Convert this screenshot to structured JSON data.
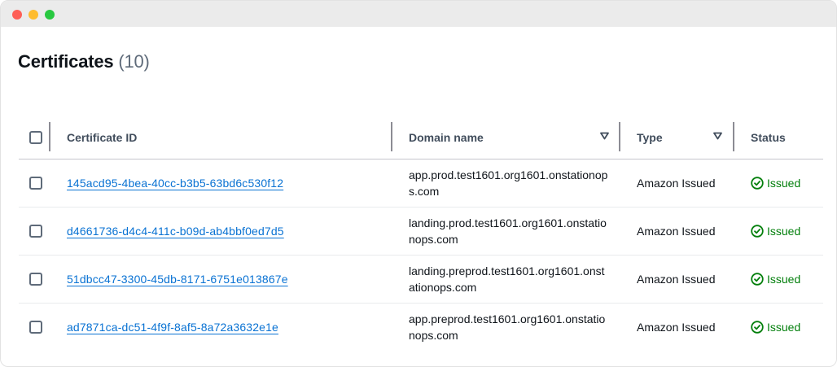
{
  "page": {
    "title": "Certificates",
    "count": "(10)"
  },
  "table": {
    "columns": {
      "certificate_id": "Certificate ID",
      "domain_name": "Domain name",
      "type": "Type",
      "status": "Status"
    },
    "rows": [
      {
        "certificate_id": "145acd95-4bea-40cc-b3b5-63bd6c530f12",
        "domain_name": "app.prod.test1601.org1601.onstationops.com",
        "type": "Amazon Issued",
        "status": "Issued"
      },
      {
        "certificate_id": "d4661736-d4c4-411c-b09d-ab4bbf0ed7d5",
        "domain_name": "landing.prod.test1601.org1601.onstationops.com",
        "type": "Amazon Issued",
        "status": "Issued"
      },
      {
        "certificate_id": "51dbcc47-3300-45db-8171-6751e013867e",
        "domain_name": "landing.preprod.test1601.org1601.onstationops.com",
        "type": "Amazon Issued",
        "status": "Issued"
      },
      {
        "certificate_id": "ad7871ca-dc51-4f9f-8af5-8a72a3632e1e",
        "domain_name": "app.preprod.test1601.org1601.onstationops.com",
        "type": "Amazon Issued",
        "status": "Issued"
      }
    ]
  },
  "icons": {
    "status": "check-circle-icon",
    "sort": "caret-down-icon"
  },
  "colors": {
    "link": "#0972d3",
    "success": "#037f0c",
    "header_text": "#414d5c"
  }
}
